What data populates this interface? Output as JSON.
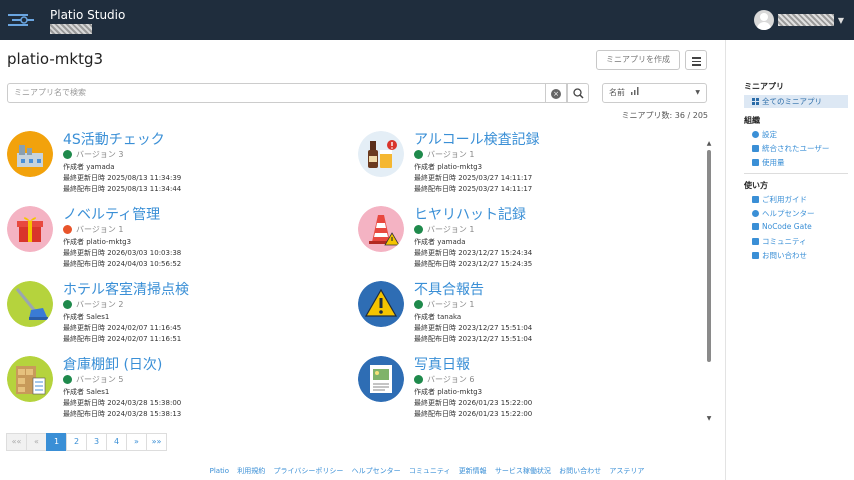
{
  "header": {
    "brand": "Platio Studio"
  },
  "main": {
    "title": "platio-mktg3",
    "create_button": "ミニアプリを作成",
    "search_placeholder": "ミニアプリ名で検索",
    "clear_symbol": "×",
    "sort_label": "名前",
    "count_text": "ミニアプリ数: 36 / 205"
  },
  "apps": [
    {
      "title": "4S活動チェック",
      "version": "バージョン 3",
      "author": "作成者 yamada",
      "updated": "最終更新日時 2025/08/13 11:34:39",
      "published": "最終配布日時 2025/08/13 11:34:44",
      "status": "#1f8a4c",
      "icon": "factory-icon"
    },
    {
      "title": "アルコール検査記録",
      "version": "バージョン 1",
      "author": "作成者 platio-mktg3",
      "updated": "最終更新日時 2025/03/27 14:11:17",
      "published": "最終配布日時 2025/03/27 14:11:17",
      "status": "#1f8a4c",
      "icon": "alcohol-icon"
    },
    {
      "title": "ノベルティ管理",
      "version": "バージョン 1",
      "author": "作成者 platio-mktg3",
      "updated": "最終更新日時 2026/03/03 10:03:38",
      "published": "最終配布日時 2024/04/03 10:56:52",
      "status": "#e8542a",
      "icon": "gift-icon"
    },
    {
      "title": "ヒヤリハット記録",
      "version": "バージョン 1",
      "author": "作成者 yamada",
      "updated": "最終更新日時 2023/12/27 15:24:34",
      "published": "最終配布日時 2023/12/27 15:24:35",
      "status": "#1f8a4c",
      "icon": "cone-icon"
    },
    {
      "title": "ホテル客室清掃点検",
      "version": "バージョン 2",
      "author": "作成者 Sales1",
      "updated": "最終更新日時 2024/02/07 11:16:45",
      "published": "最終配布日時 2024/02/07 11:16:51",
      "status": "#1f8a4c",
      "icon": "mop-icon"
    },
    {
      "title": "不具合報告",
      "version": "バージョン 1",
      "author": "作成者 tanaka",
      "updated": "最終更新日時 2023/12/27 15:51:04",
      "published": "最終配布日時 2023/12/27 15:51:04",
      "status": "#1f8a4c",
      "icon": "warning-icon"
    },
    {
      "title": "倉庫棚卸 (日次)",
      "version": "バージョン 5",
      "author": "作成者 Sales1",
      "updated": "最終更新日時 2024/03/28 15:38:00",
      "published": "最終配布日時 2024/03/28 15:38:13",
      "status": "#1f8a4c",
      "icon": "shelf-icon"
    },
    {
      "title": "写真日報",
      "version": "バージョン 6",
      "author": "作成者 platio-mktg3",
      "updated": "最終更新日時 2026/01/23 15:22:00",
      "published": "最終配布日時 2026/01/23 15:22:00",
      "status": "#1f8a4c",
      "icon": "photo-report-icon"
    }
  ],
  "pagination": [
    "««",
    "«",
    "1",
    "2",
    "3",
    "4",
    "»",
    "»»"
  ],
  "footer": [
    "Platio",
    "利用規約",
    "プライバシーポリシー",
    "ヘルプセンター",
    "コミュニティ",
    "更新情報",
    "サービス稼働状況",
    "お問い合わせ",
    "アステリア"
  ],
  "sidebar": {
    "section_apps": "ミニアプリ",
    "all_apps": "全てのミニアプリ",
    "section_org": "組織",
    "settings": "設定",
    "users": "統合されたユーザー",
    "usage": "使用量",
    "section_help": "使い方",
    "guide": "ご利用ガイド",
    "help_center": "ヘルプセンター",
    "nocode_gate": "NoCode Gate",
    "community": "コミュニティ",
    "contact": "お問い合わせ"
  }
}
